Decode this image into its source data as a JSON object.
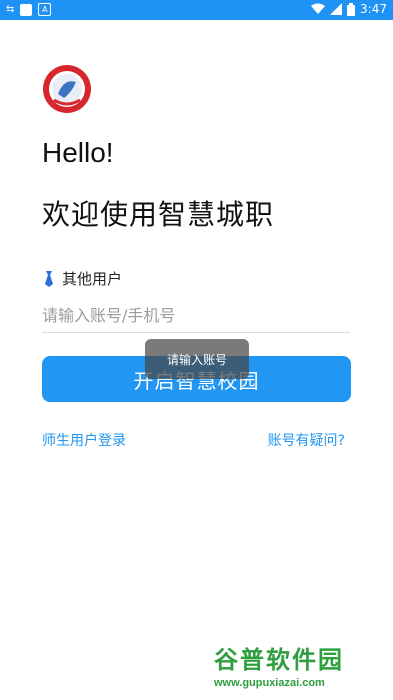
{
  "status_bar": {
    "time": "3:47",
    "icons": [
      "wifi-icon",
      "signal-icon",
      "battery-icon"
    ]
  },
  "header": {
    "logo_icon": "school-emblem-icon",
    "greeting": "Hello!",
    "welcome": "欢迎使用智慧城职"
  },
  "form": {
    "user_type_label": "其他用户",
    "account_placeholder": "请输入账号/手机号",
    "account_value": "",
    "submit_label": "开启智慧校园"
  },
  "toast": {
    "message": "请输入账号"
  },
  "links": {
    "teacher_student_login": "师生用户登录",
    "account_question": "账号有疑问?"
  },
  "watermark": {
    "title": "谷普软件园",
    "url": "www.gupuxiazai.com"
  },
  "colors": {
    "accent": "#2196f3",
    "status_bar": "#1f92f5",
    "watermark": "#2e9e3e"
  }
}
